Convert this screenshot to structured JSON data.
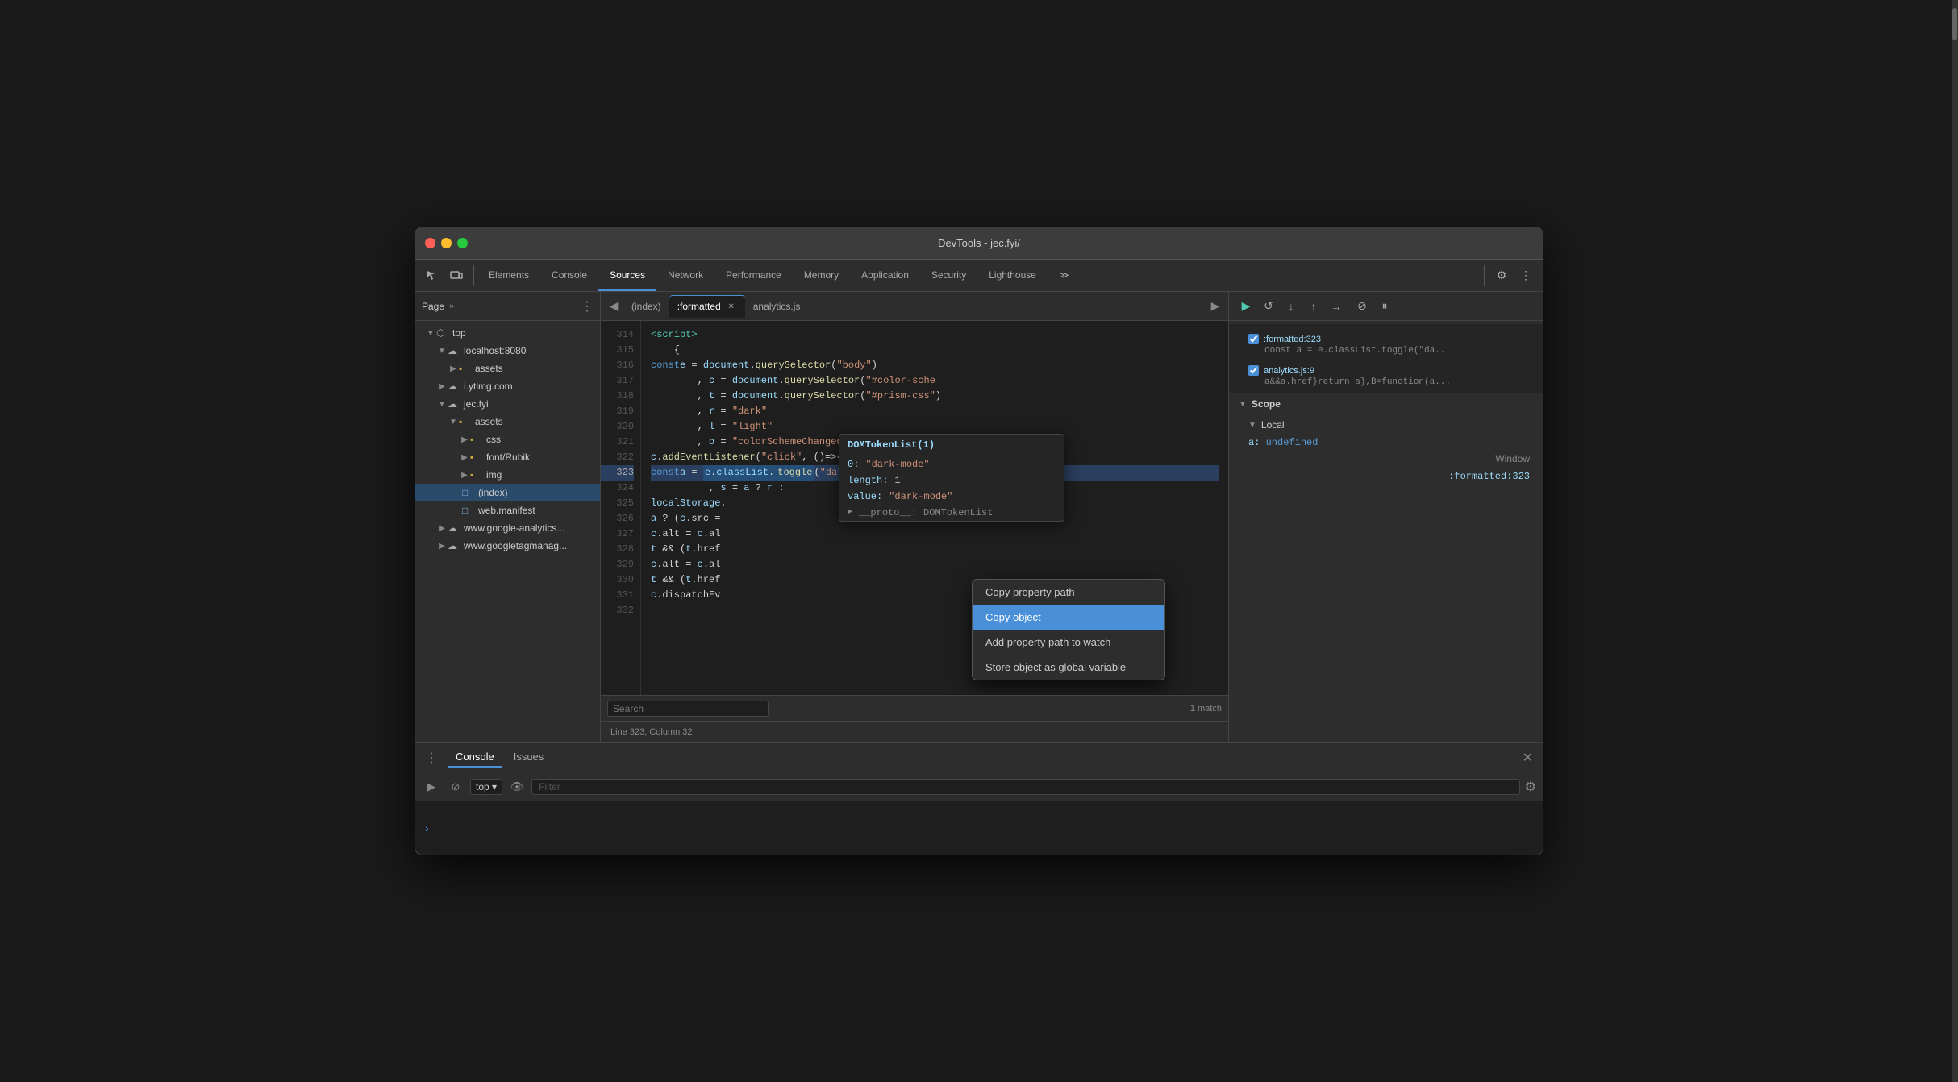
{
  "window": {
    "title": "DevTools - jec.fyi/",
    "buttons": {
      "close": "close",
      "minimize": "minimize",
      "maximize": "maximize"
    }
  },
  "toolbar": {
    "tabs": [
      {
        "label": "Elements",
        "active": false
      },
      {
        "label": "Console",
        "active": false
      },
      {
        "label": "Sources",
        "active": true
      },
      {
        "label": "Network",
        "active": false
      },
      {
        "label": "Performance",
        "active": false
      },
      {
        "label": "Memory",
        "active": false
      },
      {
        "label": "Application",
        "active": false
      },
      {
        "label": "Security",
        "active": false
      },
      {
        "label": "Lighthouse",
        "active": false
      }
    ]
  },
  "file_tree": {
    "header": "Page",
    "items": [
      {
        "label": "top",
        "type": "root",
        "indent": 0,
        "expanded": true
      },
      {
        "label": "localhost:8080",
        "type": "domain",
        "indent": 1,
        "expanded": true
      },
      {
        "label": "assets",
        "type": "folder",
        "indent": 2,
        "expanded": false
      },
      {
        "label": "i.ytimg.com",
        "type": "domain",
        "indent": 1,
        "expanded": false
      },
      {
        "label": "jec.fyi",
        "type": "domain",
        "indent": 1,
        "expanded": true
      },
      {
        "label": "assets",
        "type": "folder",
        "indent": 2,
        "expanded": true
      },
      {
        "label": "css",
        "type": "folder",
        "indent": 3,
        "expanded": false
      },
      {
        "label": "font/Rubik",
        "type": "folder",
        "indent": 3,
        "expanded": false
      },
      {
        "label": "img",
        "type": "folder",
        "indent": 3,
        "expanded": false
      },
      {
        "label": "(index)",
        "type": "file",
        "indent": 2,
        "expanded": false,
        "active": true
      },
      {
        "label": "web.manifest",
        "type": "file",
        "indent": 2,
        "expanded": false
      },
      {
        "label": "www.google-analytics...",
        "type": "domain",
        "indent": 1,
        "expanded": false
      },
      {
        "label": "www.googletagmanag...",
        "type": "domain",
        "indent": 1,
        "expanded": false
      }
    ]
  },
  "file_tabs": [
    {
      "label": "(index)",
      "active": false
    },
    {
      "label": ":formatted",
      "active": true,
      "closeable": true
    },
    {
      "label": "analytics.js",
      "active": false
    }
  ],
  "code": {
    "lines": [
      {
        "num": 314,
        "content": "  <script>",
        "highlighted": false
      },
      {
        "num": 315,
        "content": "  {",
        "highlighted": false
      },
      {
        "num": 316,
        "content": "    const e = document.querySelector(\"body\")",
        "highlighted": false
      },
      {
        "num": 317,
        "content": "      , c = document.querySelector(\"#color-sche",
        "highlighted": false
      },
      {
        "num": 318,
        "content": "      , t = document.querySelector(\"#prism-css\")",
        "highlighted": false
      },
      {
        "num": 319,
        "content": "      , r = \"dark\"",
        "highlighted": false
      },
      {
        "num": 320,
        "content": "      , l = \"light\"",
        "highlighted": false
      },
      {
        "num": 321,
        "content": "      , o = \"colorSchemeChanged\";",
        "highlighted": false
      },
      {
        "num": 322,
        "content": "    c.addEventListener(\"click\", ()=>{",
        "highlighted": false
      },
      {
        "num": 323,
        "content": "      const a = e.classList.toggle(\"dark-mo",
        "highlighted": true
      },
      {
        "num": 324,
        "content": "        , s = a ? r :",
        "highlighted": false
      },
      {
        "num": 325,
        "content": "      localStorage.",
        "highlighted": false
      },
      {
        "num": 326,
        "content": "      a ? (c.src =",
        "highlighted": false
      },
      {
        "num": 327,
        "content": "      c.alt = c.al",
        "highlighted": false
      },
      {
        "num": 328,
        "content": "      t && (t.href",
        "highlighted": false
      },
      {
        "num": 329,
        "content": "      c.alt = c.al",
        "highlighted": false
      },
      {
        "num": 330,
        "content": "      t && (t.href",
        "highlighted": false
      },
      {
        "num": 331,
        "content": "      c.dispatchEv",
        "highlighted": false
      },
      {
        "num": 332,
        "content": "",
        "highlighted": false
      }
    ]
  },
  "tooltip": {
    "title": "DOMTokenList(1)",
    "rows": [
      {
        "key": "0:",
        "value": "\"dark-mode\""
      },
      {
        "key": "length:",
        "value": "1"
      },
      {
        "key": "value:",
        "value": "\"dark-mode\""
      },
      {
        "key": "▶ __proto__:",
        "value": "DOMTokenList"
      }
    ]
  },
  "context_menu": {
    "items": [
      {
        "label": "Copy property path",
        "selected": false
      },
      {
        "label": "Copy object",
        "selected": true
      },
      {
        "label": "Add property path to watch",
        "selected": false
      },
      {
        "label": "Store object as global variable",
        "selected": false
      }
    ]
  },
  "debugger": {
    "breakpoints": [
      {
        "file": ":formatted:323",
        "code": "const a = e.classList.toggle(\"da...",
        "checked": true
      },
      {
        "file": "analytics.js:9",
        "code": "a&&a.href}return a},B=function(a...",
        "checked": true
      }
    ],
    "scope": {
      "title": "Scope",
      "local": {
        "title": "Local",
        "vars": [
          {
            "key": "a:",
            "value": "undefined",
            "type": "undefined"
          }
        ]
      },
      "window_label": "Window",
      "call_stack_file": ":formatted:323"
    }
  },
  "status_bar": {
    "position": "Line 323, Column 32"
  },
  "search": {
    "placeholder": "Search",
    "match_count": "1 match"
  },
  "console": {
    "tabs": [
      {
        "label": "Console",
        "active": true
      },
      {
        "label": "Issues",
        "active": false
      }
    ],
    "top_label": "top",
    "filter_placeholder": "Filter"
  }
}
